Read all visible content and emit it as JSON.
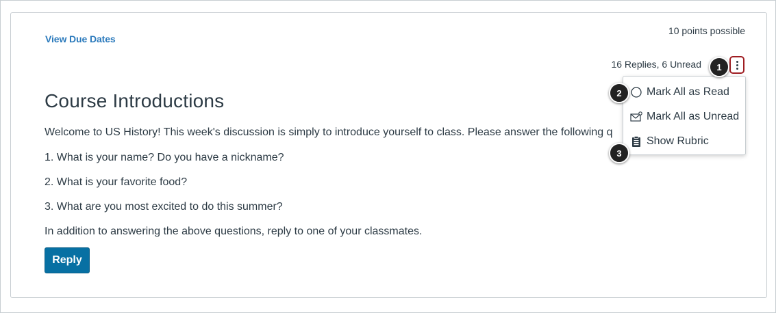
{
  "header": {
    "view_due_dates": "View Due Dates",
    "points_possible": "10 points possible",
    "replies_status": "16 Replies, 6 Unread"
  },
  "discussion": {
    "title": "Course Introductions",
    "intro": "Welcome to US History! This week's discussion is simply to introduce yourself to class. Please answer the following questions:",
    "questions": [
      "1. What is your name? Do you have a nickname?",
      "2. What is your favorite food?",
      "3. What are you most excited to do this summer?"
    ],
    "addition": "In addition to answering the above questions, reply to one of your classmates.",
    "reply_label": "Reply"
  },
  "menu": {
    "items": [
      {
        "label": "Mark All as Read",
        "icon": "circle-outline-icon"
      },
      {
        "label": "Mark All as Unread",
        "icon": "envelope-icon"
      },
      {
        "label": "Show Rubric",
        "icon": "clipboard-icon"
      }
    ]
  },
  "callouts": [
    "1",
    "2",
    "3"
  ],
  "colors": {
    "link": "#2b7abc",
    "button": "#0770a3",
    "highlight_border": "#9f1d22",
    "text": "#2d3b45"
  }
}
